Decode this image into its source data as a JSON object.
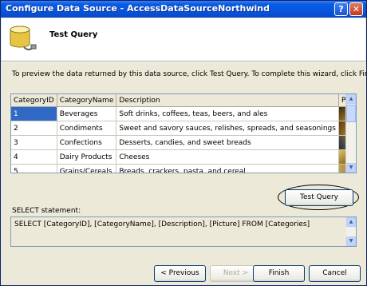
{
  "window": {
    "title": "Configure Data Source - AccessDataSourceNorthwind"
  },
  "header": {
    "title": "Test Query"
  },
  "intro_text": "To preview the data returned by this data source, click Test Query. To complete this wizard, click Finish.",
  "grid": {
    "columns": [
      "CategoryID",
      "CategoryName",
      "Description",
      "Picture"
    ],
    "rows": [
      [
        "1",
        "Beverages",
        "Soft drinks, coffees, teas, beers, and ales"
      ],
      [
        "2",
        "Condiments",
        "Sweet and savory sauces, relishes, spreads, and seasonings"
      ],
      [
        "3",
        "Confections",
        "Desserts, candies, and sweet breads"
      ],
      [
        "4",
        "Dairy Products",
        "Cheeses"
      ],
      [
        "5",
        "Grains/Cereals",
        "Breads, crackers, pasta, and cereal"
      ]
    ]
  },
  "test_query_button": "Test Query",
  "select_label": "SELECT statement:",
  "select_statement": "SELECT [CategoryID], [CategoryName], [Description], [Picture] FROM [Categories]",
  "buttons": {
    "previous": "< Previous",
    "next": "Next >",
    "finish": "Finish",
    "cancel": "Cancel"
  },
  "colors": {
    "titlebar": "#0a5be4",
    "selection": "#316ac5",
    "dialog_bg": "#ece9d8"
  },
  "icons": {
    "database": "database-icon",
    "help": "help-icon",
    "close": "close-icon"
  }
}
